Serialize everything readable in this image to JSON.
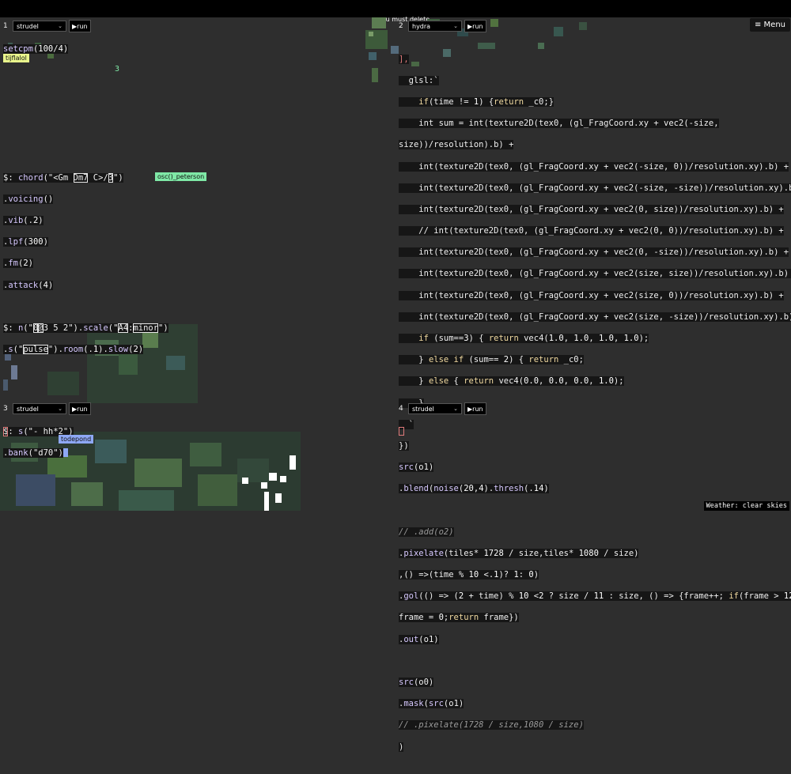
{
  "top_warning": "you must delete",
  "menu": {
    "label": "≡ Menu"
  },
  "status": {
    "weather": "Weather: clear skies"
  },
  "panes": [
    {
      "num": "1",
      "engine": "strudel",
      "run": "▶run"
    },
    {
      "num": "2",
      "engine": "hydra",
      "run": "▶run"
    },
    {
      "num": "3",
      "engine": "strudel",
      "run": "▶run"
    },
    {
      "num": "4",
      "engine": "strudel",
      "run": "▶run"
    }
  ],
  "users": {
    "tijflalol": "tijflalol",
    "osc_peterson": "osc()_peterson",
    "todepond": "todepond"
  },
  "pane1_text": {
    "stray": "3"
  },
  "colors": {
    "tag_yellow": "#e9f58c",
    "tag_green": "#7fe8a6",
    "tag_blue": "#8ea8f5",
    "accent_red": "#e07b7b"
  }
}
